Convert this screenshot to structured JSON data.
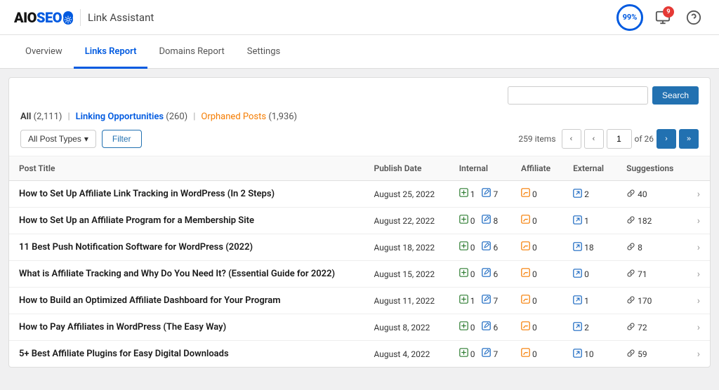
{
  "header": {
    "logo_text": "AIOSEO",
    "title": "Link Assistant",
    "score": "99%",
    "notification_count": "9"
  },
  "nav": {
    "tabs": [
      {
        "id": "overview",
        "label": "Overview",
        "active": false
      },
      {
        "id": "links-report",
        "label": "Links Report",
        "active": true
      },
      {
        "id": "domains-report",
        "label": "Domains Report",
        "active": false
      },
      {
        "id": "settings",
        "label": "Settings",
        "active": false
      }
    ]
  },
  "filter": {
    "all_label": "All",
    "all_count": "(2,111)",
    "linking_label": "Linking Opportunities",
    "linking_count": "(260)",
    "orphaned_label": "Orphaned Posts",
    "orphaned_count": "(1,936)",
    "post_types_label": "All Post Types",
    "filter_label": "Filter",
    "items_count": "259 items",
    "search_placeholder": "",
    "search_button": "Search",
    "page_current": "1",
    "page_total": "of 26"
  },
  "table": {
    "columns": [
      "Post Title",
      "Publish Date",
      "Internal",
      "Affiliate",
      "External",
      "Suggestions"
    ],
    "rows": [
      {
        "title": "How to Set Up Affiliate Link Tracking in WordPress (In 2 Steps)",
        "date": "August 25, 2022",
        "internal_add": "1",
        "internal_edit": "7",
        "affiliate": "0",
        "external": "2",
        "suggestions": "40"
      },
      {
        "title": "How to Set Up an Affiliate Program for a Membership Site",
        "date": "August 22, 2022",
        "internal_add": "0",
        "internal_edit": "8",
        "affiliate": "0",
        "external": "1",
        "suggestions": "182"
      },
      {
        "title": "11 Best Push Notification Software for WordPress (2022)",
        "date": "August 18, 2022",
        "internal_add": "0",
        "internal_edit": "6",
        "affiliate": "0",
        "external": "18",
        "suggestions": "8"
      },
      {
        "title": "What is Affiliate Tracking and Why Do You Need It? (Essential Guide for 2022)",
        "date": "August 15, 2022",
        "internal_add": "0",
        "internal_edit": "6",
        "affiliate": "0",
        "external": "0",
        "suggestions": "71"
      },
      {
        "title": "How to Build an Optimized Affiliate Dashboard for Your Program",
        "date": "August 11, 2022",
        "internal_add": "1",
        "internal_edit": "7",
        "affiliate": "0",
        "external": "1",
        "suggestions": "170"
      },
      {
        "title": "How to Pay Affiliates in WordPress (The Easy Way)",
        "date": "August 8, 2022",
        "internal_add": "0",
        "internal_edit": "6",
        "affiliate": "0",
        "external": "2",
        "suggestions": "72"
      },
      {
        "title": "5+ Best Affiliate Plugins for Easy Digital Downloads",
        "date": "August 4, 2022",
        "internal_add": "0",
        "internal_edit": "7",
        "affiliate": "0",
        "external": "10",
        "suggestions": "59"
      }
    ]
  }
}
